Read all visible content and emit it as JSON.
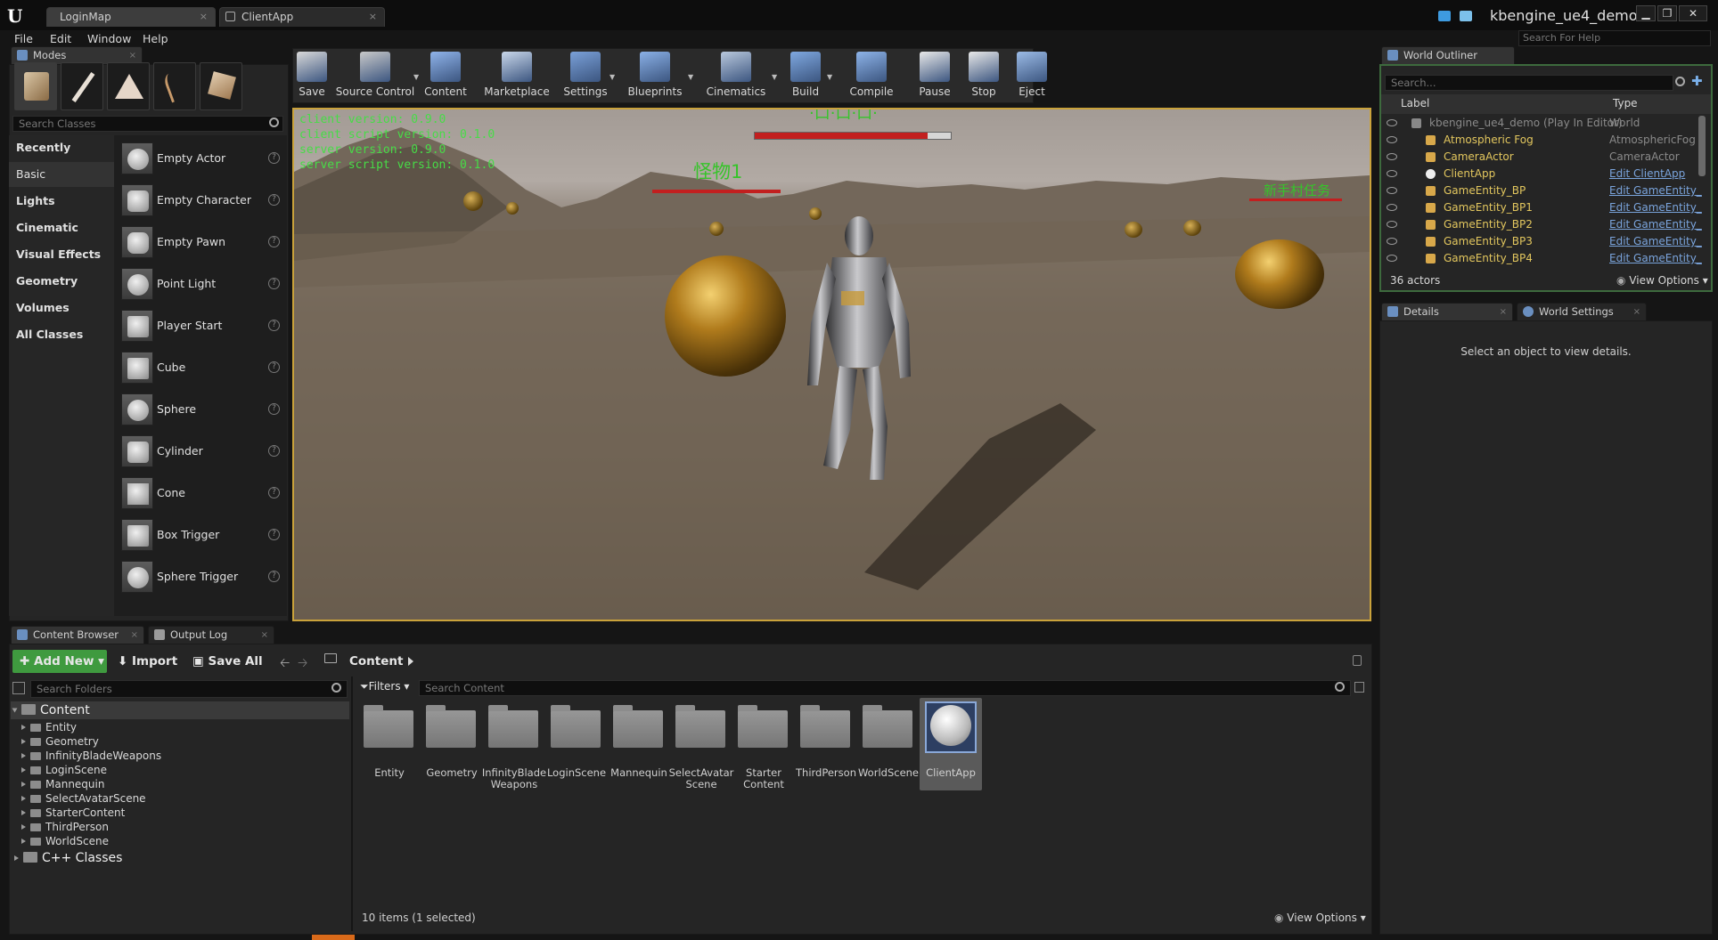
{
  "window": {
    "tabs": [
      {
        "label": "LoginMap",
        "close": "×"
      },
      {
        "label": "ClientApp",
        "close": "×"
      }
    ],
    "app_name": "kbengine_ue4_demo",
    "buttons": {
      "minimize": "▁",
      "restore": "❐",
      "close": "✕"
    }
  },
  "menu": {
    "items": [
      "File",
      "Edit",
      "Window",
      "Help"
    ],
    "help_search": "Search For Help"
  },
  "modes": {
    "tab": "Modes",
    "close": "×",
    "search_placeholder": "Search Classes",
    "categories": [
      "Recently Placed",
      "Basic",
      "Lights",
      "Cinematic",
      "Visual Effects",
      "Geometry",
      "Volumes",
      "All Classes"
    ],
    "active_category": "Basic",
    "actors": [
      "Empty Actor",
      "Empty Character",
      "Empty Pawn",
      "Point Light",
      "Player Start",
      "Cube",
      "Sphere",
      "Cylinder",
      "Cone",
      "Box Trigger",
      "Sphere Trigger"
    ],
    "help_glyph": "?"
  },
  "toolbar": {
    "buttons": [
      {
        "label": "Save",
        "icon": "save-icon",
        "color": "#d9d9d9"
      },
      {
        "label": "Source Control",
        "icon": "source-control-icon",
        "color": "#c9c9c9"
      },
      {
        "label": "Content",
        "icon": "content-icon",
        "color": "#8fb3ea"
      },
      {
        "label": "Marketplace",
        "icon": "marketplace-icon",
        "color": "#c9d7ea"
      },
      {
        "label": "Settings",
        "icon": "settings-icon",
        "color": "#7aa0d8"
      },
      {
        "label": "Blueprints",
        "icon": "blueprints-icon",
        "color": "#8ab0e6"
      },
      {
        "label": "Cinematics",
        "icon": "cinematics-icon",
        "color": "#b9c8dc"
      },
      {
        "label": "Build",
        "icon": "build-icon",
        "color": "#7fa8e0"
      },
      {
        "label": "Compile",
        "icon": "compile-icon",
        "color": "#8db3e8"
      },
      {
        "label": "Pause",
        "icon": "pause-icon",
        "color": "#e8e8e8"
      },
      {
        "label": "Stop",
        "icon": "stop-icon",
        "color": "#e8e8e8"
      },
      {
        "label": "Eject",
        "icon": "eject-icon",
        "color": "#9bbbe6"
      }
    ],
    "dropdown_glyph": "▼"
  },
  "viewport": {
    "versions": [
      "client version: 0.9.0",
      "client script version: 0.1.0",
      "server version: 0.9.0",
      "server script version: 0.1.0"
    ],
    "labels": [
      "怪物1",
      "新手村任务"
    ],
    "top_label": "·口·口·口·",
    "player_health": 0.88
  },
  "outliner": {
    "tab": "World Outliner",
    "search_placeholder": "Search...",
    "col_label": "Label",
    "col_type": "Type",
    "rows": [
      {
        "label": "kbengine_ue4_demo (Play In Editor)",
        "type": "World",
        "link": false
      },
      {
        "label": "Atmospheric Fog",
        "type": "AtmosphericFog",
        "link": false
      },
      {
        "label": "CameraActor",
        "type": "CameraActor",
        "link": false
      },
      {
        "label": "ClientApp",
        "type": "Edit ClientApp",
        "link": true
      },
      {
        "label": "GameEntity_BP",
        "type": "Edit GameEntity_",
        "link": true
      },
      {
        "label": "GameEntity_BP1",
        "type": "Edit GameEntity_",
        "link": true
      },
      {
        "label": "GameEntity_BP2",
        "type": "Edit GameEntity_",
        "link": true
      },
      {
        "label": "GameEntity_BP3",
        "type": "Edit GameEntity_",
        "link": true
      },
      {
        "label": "GameEntity_BP4",
        "type": "Edit GameEntity_",
        "link": true
      }
    ],
    "count": "36 actors",
    "view_options": "View Options"
  },
  "details": {
    "tab": "Details",
    "tab2": "World Settings",
    "empty": "Select an object to view details."
  },
  "content_browser": {
    "tab": "Content Browser",
    "tab2": "Output Log",
    "add_new": "Add New",
    "import": "Import",
    "save_all": "Save All",
    "path": "Content",
    "search_folders": "Search Folders",
    "filters": "Filters",
    "search_content": "Search Content",
    "tree_root": "Content",
    "tree": [
      "Entity",
      "Geometry",
      "InfinityBladeWeapons",
      "LoginScene",
      "Mannequin",
      "SelectAvatarScene",
      "StarterContent",
      "ThirdPerson",
      "WorldScene"
    ],
    "cpp": "C++ Classes",
    "assets": [
      "Entity",
      "Geometry",
      "InfinityBlade Weapons",
      "LoginScene",
      "Mannequin",
      "SelectAvatar Scene",
      "Starter Content",
      "ThirdPerson",
      "WorldScene",
      "ClientApp"
    ],
    "selected_asset": "ClientApp",
    "status": "10 items (1 selected)",
    "view_options": "View Options"
  }
}
